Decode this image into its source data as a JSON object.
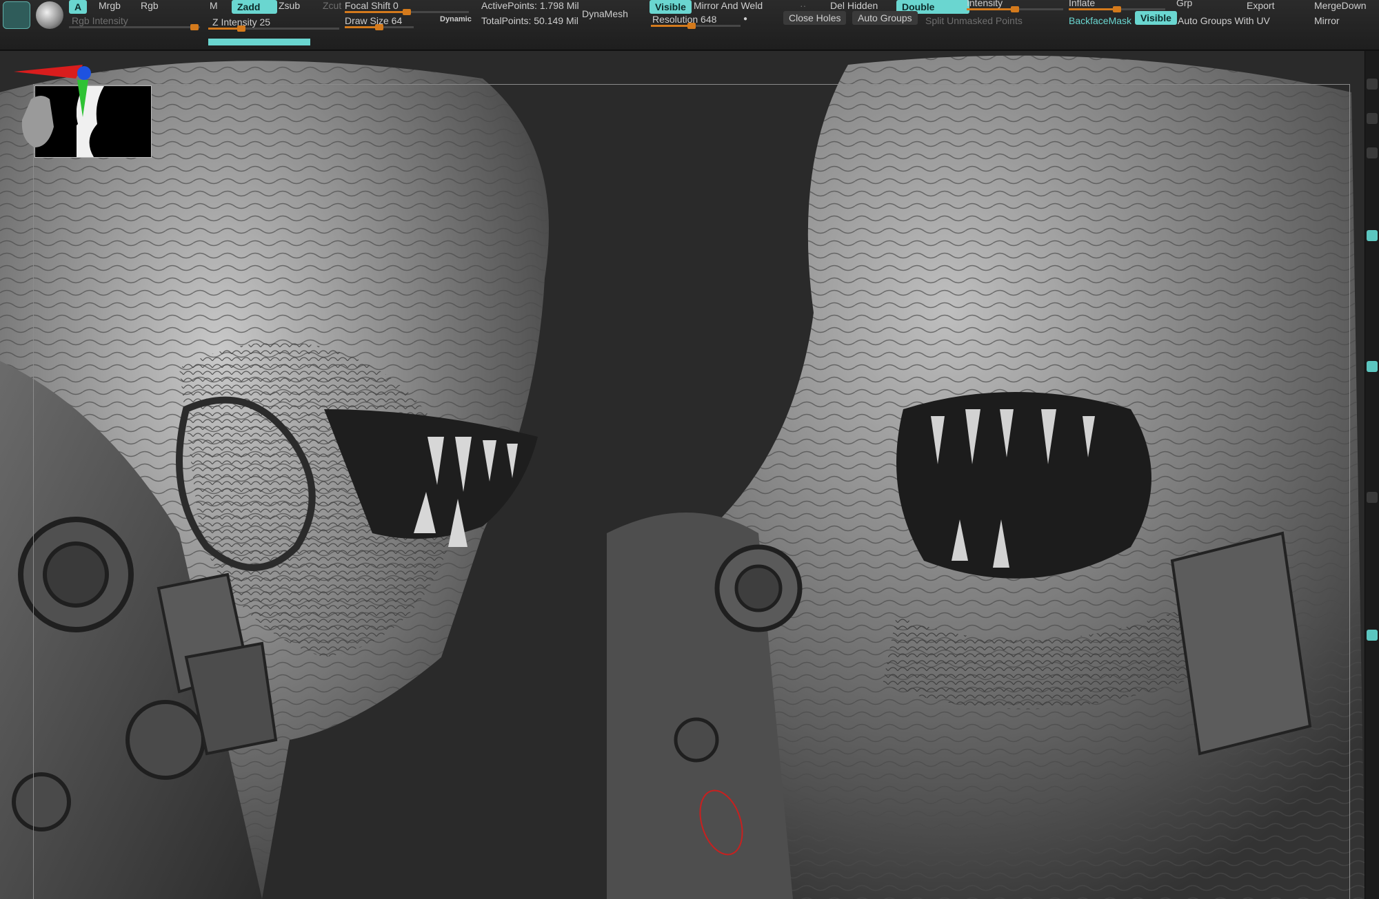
{
  "shelf": {
    "row1": {
      "a": "A",
      "mrgb": "Mrgb",
      "rgb": "Rgb",
      "m": "M",
      "zadd": "Zadd",
      "zsub": "Zsub",
      "zcut": "Zcut",
      "focal_shift": "Focal Shift 0",
      "active_points": "ActivePoints: 1.798 Mil",
      "visible": "Visible",
      "mirror_and_weld": "Mirror And Weld",
      "del_hidden": "Del Hidden",
      "double": "Double",
      "intensity": "Intensity",
      "inflate": "Inflate",
      "grp": "Grp",
      "export": "Export",
      "merge_down": "MergeDown"
    },
    "row2": {
      "rgb_intensity": "Rgb Intensity",
      "z_intensity": "Z Intensity 25",
      "draw_size": "Draw Size 64",
      "dynamic": "Dynamic",
      "total_points": "TotalPoints: 50.149 Mil",
      "dynamesh": "DynaMesh",
      "resolution": "Resolution 648",
      "close_holes": "Close Holes",
      "auto_groups": "Auto Groups",
      "split_unmasked": "Split Unmasked Points",
      "backface_mask": "BackfaceMask",
      "visible2": "Visible",
      "auto_groups_uv": "Auto Groups With UV",
      "mirror": "Mirror"
    },
    "levels": {
      "z_intensity": 0.25,
      "draw_size": 0.5,
      "focal_shift": 0.5,
      "resolution": 0.45,
      "intensity": 0.5,
      "inflate": 0.5
    }
  },
  "colors": {
    "accent": "#6ad6d0",
    "slider": "#d47a1c",
    "viewport_bg": "#2a2a2a"
  },
  "icons": [
    "zbrush-logo-icon",
    "sphere-material-icon",
    "axis-gizmo-icon",
    "head-orientation-icon"
  ]
}
